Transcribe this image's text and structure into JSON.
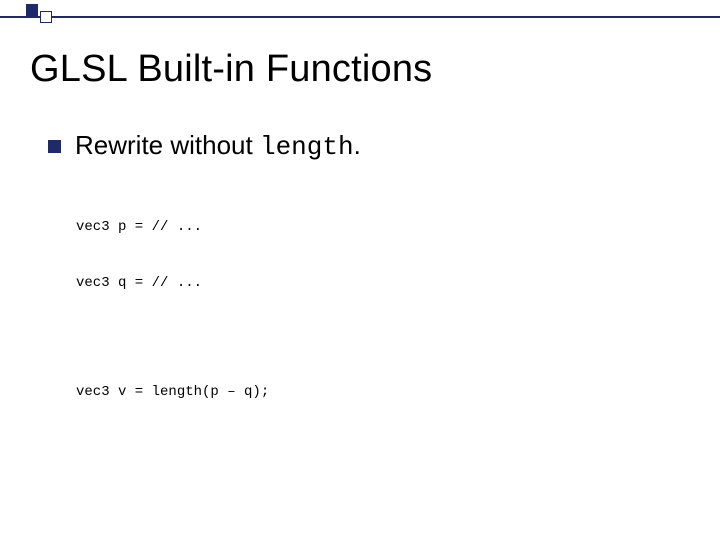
{
  "title": "GLSL Built-in Functions",
  "bullet": {
    "prefix": "Rewrite without ",
    "mono": "length",
    "suffix": "."
  },
  "code": {
    "line1": "vec3 p = // ...",
    "line2": "vec3 q = // ...",
    "line3": "vec3 v = length(p – q);"
  }
}
